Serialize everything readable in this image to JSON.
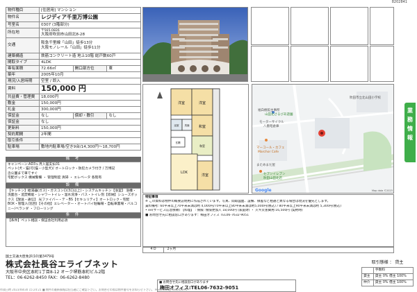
{
  "doc_id": "8202841",
  "spec": {
    "rows": [
      {
        "key": "物件種目",
        "value": "[住居用] マンション"
      },
      {
        "key": "物件名",
        "value": "レジディア千里万博公園"
      },
      {
        "key": "号室名",
        "value": "0307 (3階部分)"
      },
      {
        "key": "所在地",
        "value_small": "〒565-0826",
        "value": "大阪府吹田市山田北8-28"
      },
      {
        "key": "交通",
        "value": "阪急千里線「山田」徒歩13分",
        "value2": "大阪モノレール「山田」徒歩11分"
      },
      {
        "key": "建築構造",
        "value": "鉄筋コンクリート造 地上10階 総戸数60戸"
      },
      {
        "key": "間取タイプ",
        "value": "4LDK"
      },
      {
        "key": "専有面積",
        "value": "72.66㎡",
        "sub_key": "開口部方位",
        "sub_value": "東"
      },
      {
        "key": "築年",
        "value": "2005年10月"
      },
      {
        "key": "現況/入居時期",
        "value": "空室 / 即入"
      },
      {
        "key": "賃料",
        "value": "150,000 円"
      },
      {
        "key": "共益費・管理費",
        "value": "18,000円"
      },
      {
        "key": "敷金",
        "value": "150,000円"
      },
      {
        "key": "礼金",
        "value": "300,000円"
      },
      {
        "key": "保証金",
        "value": "なし",
        "sub_key": "償却・敷引",
        "sub_value": "なし"
      },
      {
        "key": "保証金",
        "value": "なし"
      },
      {
        "key": "更新料",
        "value": "150,000円"
      },
      {
        "key": "契約期間",
        "value": "2年間"
      },
      {
        "key": "取引条件",
        "value": ""
      },
      {
        "key": "駐車場",
        "value": "敷地内駐車場/空き9台/14,300円〜18,700円"
      }
    ]
  },
  "sections": {
    "remarks_title": "備 考",
    "remarks": [
      "キャンペーン:AD3ヶ月入居支払01",
      "ペット(犬・猫)可(猫・小型犬)/ オートロック・防犯カメラ付き / 万博記",
      "念公園まで車ですぐ",
      "宅配ボックス 機械警備 ・ 管理制度 清掃 ・ エレベータ 各階有"
    ],
    "facilities_title": "設 備",
    "facilities": "【キッチン】給湯器(ガス)・ガスコンロ(3口以上)・システムキッチン【浴室】 浴槽・洗面台・追焚機能・シャワートイレ・温水洗浄・バス・トイレ別【収納】シューズボックス【放送・通信】 光ファイバー・テ・BS【セキュリティ】オートロック・宅配BOX・管理人(巡回)【その他】エレベーター・オートバイ駐輪場・自転車置場・バルコニー/ベランダ ・フローリング",
    "conditions_title": "条 件",
    "conditions": "【条件】ペット相談・保証会社利用必須"
  },
  "floorplan": {
    "rooms": [
      "洋室",
      "和室",
      "洋室",
      "LDK",
      "洋室",
      "和室",
      "洋室"
    ],
    "labels": [
      "浴室",
      "洗面",
      "バルコニー",
      "玄関",
      "収納",
      "PS"
    ]
  },
  "map": {
    "labels": {
      "school": "吹田市立北山田小学校",
      "station": "福白樹館主事所",
      "park": "山田北さるびあ遊園",
      "cafe": "マーコール・カフェ",
      "cafe_en": "Marchor Cafe",
      "seven": "セブンイレブン",
      "seven2": "吹田山田北店",
      "mame": "まためまだ屋",
      "cycle": "モーターサイクル",
      "cycle2": "八重昭倉庫",
      "data": "Map data ©2023",
      "google": "Google"
    }
  },
  "notes": {
    "title": "特記事項",
    "lines": [
      "※ この資料は物件の概要説明用に作成されています。写真、間取図面、設備、微差など相違と異なる場合は現況を優先とします。",
      "賃料備考: 60平米以上70平米未満は約 4,000円/70平米以上80平米未満は約5,000円(税込) / 80平米以上90平米未満は約 5,300円(税込)",
      "• ee(サービス応急依頼) 【料理】 : 保険: 保険更加入 18,000円 (家庭財) ・ 火キ災害費用:16,500円 (契約時)",
      "■ お問合せ先に相談窓口があります：梅田オフィス TEL06-7632-9051"
    ]
  },
  "dates": {
    "label": "4 D",
    "value": "2ヶ月"
  },
  "side_tab": [
    "業",
    "務",
    "情",
    "報"
  ],
  "footer": {
    "license": "国土交通大臣免許(10)第3479号",
    "company": "株式会社長谷エライブネット",
    "address": "大阪市中央区本町1丁目8-12 オーク堺筋本町ビル2階",
    "tel": "TEL：06-6262-8450 FAX：06-6262-8480",
    "contact_label": "■ お問合せ先に相談窓口があります",
    "contact_tel": "梅田オフィス:TEL06-7632-9051",
    "deal_title": "取引態様 ： 貸主",
    "deal_rows": [
      [
        "",
        "手数料"
      ],
      [
        "貸主",
        "貸主 0% 借主 100%"
      ],
      [
        "仲介",
        "貸主 0% 借主 100%"
      ]
    ],
    "bottom": "作成日時 2023/08/30 15:24:21   ■ 物件の最新情報は担当者にご確認下さい。お問合せの際は物件番号をお知らせ下さい。   Powered by RealNetPro"
  }
}
